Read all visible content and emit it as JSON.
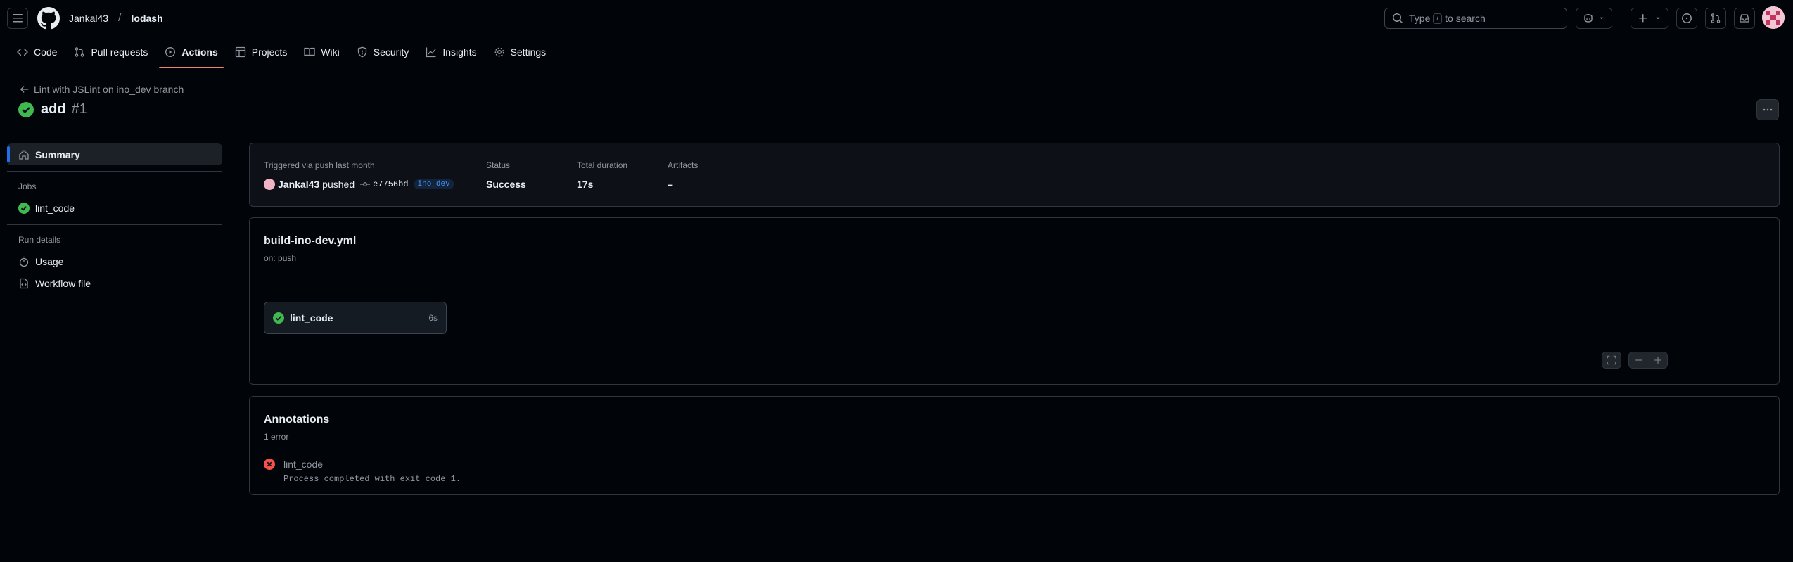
{
  "header": {
    "owner": "Jankal43",
    "separator": "/",
    "repo": "lodash",
    "search": {
      "prefix": "Type",
      "key": "/",
      "suffix": "to search"
    }
  },
  "tabs": [
    {
      "label": "Code",
      "icon": "code-icon"
    },
    {
      "label": "Pull requests",
      "icon": "pull-request-icon"
    },
    {
      "label": "Actions",
      "icon": "play-icon",
      "active": true
    },
    {
      "label": "Projects",
      "icon": "table-icon"
    },
    {
      "label": "Wiki",
      "icon": "book-icon"
    },
    {
      "label": "Security",
      "icon": "shield-icon"
    },
    {
      "label": "Insights",
      "icon": "graph-icon"
    },
    {
      "label": "Settings",
      "icon": "gear-icon"
    }
  ],
  "run": {
    "back_link": "Lint with JSLint on ino_dev branch",
    "title": "add",
    "number": "#1"
  },
  "sidebar": {
    "summary": "Summary",
    "jobs_heading": "Jobs",
    "job": "lint_code",
    "run_details_heading": "Run details",
    "usage": "Usage",
    "workflow_file": "Workflow file"
  },
  "summary": {
    "trigger_label": "Triggered via push last month",
    "actor": "Jankal43",
    "action": "pushed",
    "sha": "e7756bd",
    "branch": "ino_dev",
    "status_label": "Status",
    "status_value": "Success",
    "duration_label": "Total duration",
    "duration_value": "17s",
    "artifacts_label": "Artifacts",
    "artifacts_value": "–"
  },
  "graph": {
    "workflow_file": "build-ino-dev.yml",
    "trigger": "on: push",
    "job_name": "lint_code",
    "job_duration": "6s"
  },
  "annotations": {
    "title": "Annotations",
    "count": "1 error",
    "item_job": "lint_code",
    "item_message": "Process completed with exit code 1."
  },
  "colors": {
    "success": "#3fb950",
    "error": "#f85149",
    "accent": "#1f6feb",
    "active_tab_underline": "#f78166"
  }
}
